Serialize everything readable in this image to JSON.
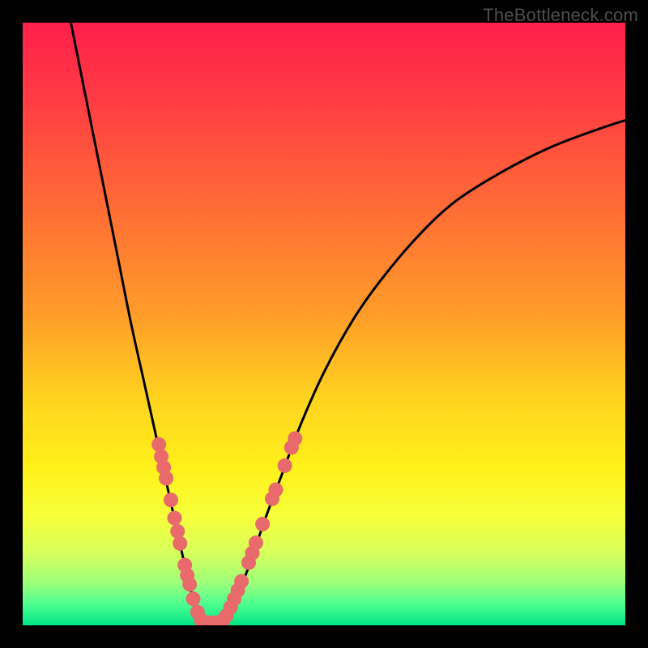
{
  "watermark": "TheBottleneck.com",
  "gradient": {
    "stops": [
      {
        "offset": 0.0,
        "color": "#ff1f4b"
      },
      {
        "offset": 0.12,
        "color": "#ff3a44"
      },
      {
        "offset": 0.3,
        "color": "#ff6a36"
      },
      {
        "offset": 0.48,
        "color": "#ff9b2a"
      },
      {
        "offset": 0.62,
        "color": "#ffd21f"
      },
      {
        "offset": 0.74,
        "color": "#fff11a"
      },
      {
        "offset": 0.82,
        "color": "#f6ff3a"
      },
      {
        "offset": 0.88,
        "color": "#d6ff5c"
      },
      {
        "offset": 0.93,
        "color": "#9cff7a"
      },
      {
        "offset": 0.965,
        "color": "#4cff90"
      },
      {
        "offset": 1.0,
        "color": "#00e585"
      }
    ]
  },
  "chart_data": {
    "type": "line",
    "title": "",
    "xlabel": "",
    "ylabel": "",
    "xlim": [
      0,
      100
    ],
    "ylim": [
      0,
      100
    ],
    "series": [
      {
        "name": "left-curve",
        "x": [
          8,
          10,
          12,
          14,
          16,
          18,
          20,
          22,
          24,
          26,
          27,
          28,
          29,
          29.8
        ],
        "y": [
          100,
          90,
          80,
          70,
          60,
          50,
          41,
          32,
          23,
          14,
          9.5,
          5.5,
          2.5,
          0.5
        ]
      },
      {
        "name": "right-curve",
        "x": [
          33,
          34,
          36,
          38,
          40,
          43,
          46,
          50,
          55,
          60,
          66,
          72,
          80,
          88,
          96,
          100
        ],
        "y": [
          0.5,
          2,
          6,
          11,
          17,
          25,
          33,
          42,
          51,
          58,
          65,
          70.5,
          75.5,
          79.5,
          82.5,
          83.8
        ]
      }
    ],
    "markers": [
      {
        "x": 22.6,
        "y": 30.0
      },
      {
        "x": 23.0,
        "y": 28.0
      },
      {
        "x": 23.4,
        "y": 26.2
      },
      {
        "x": 23.8,
        "y": 24.4
      },
      {
        "x": 24.6,
        "y": 20.8
      },
      {
        "x": 25.2,
        "y": 17.8
      },
      {
        "x": 25.7,
        "y": 15.6
      },
      {
        "x": 26.1,
        "y": 13.6
      },
      {
        "x": 26.9,
        "y": 10.0
      },
      {
        "x": 27.3,
        "y": 8.3
      },
      {
        "x": 27.7,
        "y": 6.8
      },
      {
        "x": 28.3,
        "y": 4.4
      },
      {
        "x": 29.0,
        "y": 2.2
      },
      {
        "x": 29.6,
        "y": 0.9
      },
      {
        "x": 30.2,
        "y": 0.5
      },
      {
        "x": 30.8,
        "y": 0.4
      },
      {
        "x": 31.4,
        "y": 0.4
      },
      {
        "x": 32.0,
        "y": 0.4
      },
      {
        "x": 32.6,
        "y": 0.5
      },
      {
        "x": 33.2,
        "y": 0.8
      },
      {
        "x": 33.8,
        "y": 1.6
      },
      {
        "x": 34.5,
        "y": 3.0
      },
      {
        "x": 35.1,
        "y": 4.4
      },
      {
        "x": 35.7,
        "y": 5.8
      },
      {
        "x": 36.3,
        "y": 7.3
      },
      {
        "x": 37.5,
        "y": 10.4
      },
      {
        "x": 38.1,
        "y": 12.0
      },
      {
        "x": 38.7,
        "y": 13.7
      },
      {
        "x": 39.8,
        "y": 16.8
      },
      {
        "x": 41.4,
        "y": 21.0
      },
      {
        "x": 42.0,
        "y": 22.5
      },
      {
        "x": 43.5,
        "y": 26.5
      },
      {
        "x": 44.6,
        "y": 29.5
      },
      {
        "x": 45.2,
        "y": 31.0
      }
    ],
    "marker_style": {
      "color": "#e86a6a",
      "radius_px": 9
    }
  }
}
